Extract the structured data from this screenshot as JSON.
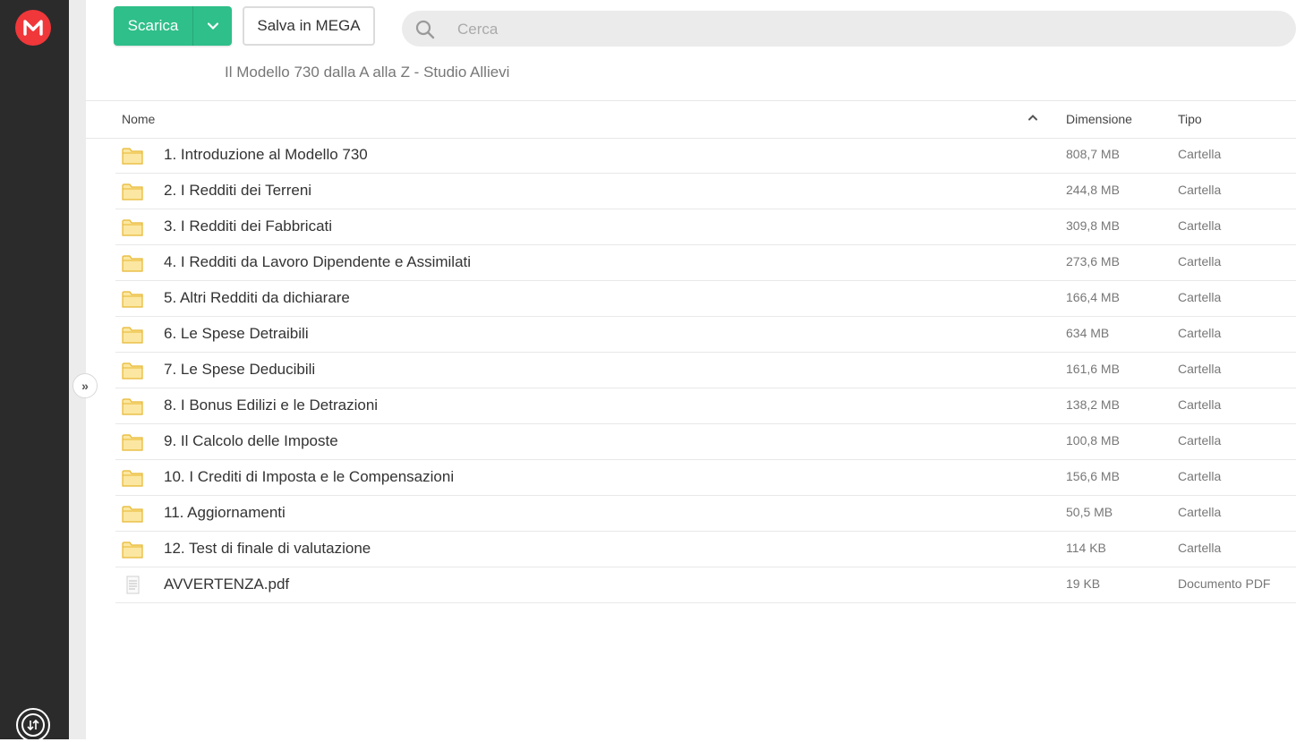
{
  "sidebar": {
    "logo_letter": "M",
    "logo_color": "#f0373a",
    "transfer_icon": "transfer-arrows-icon",
    "expand_glyph": "»"
  },
  "toolbar": {
    "download_label": "Scarica",
    "download_color": "#2fbf8a",
    "save_label": "Salva in MEGA"
  },
  "search": {
    "placeholder": "Cerca",
    "value": ""
  },
  "folder_title": "Il Modello 730 dalla A alla Z - Studio Allievi",
  "table": {
    "columns": {
      "name": "Nome",
      "size": "Dimensione",
      "type": "Tipo"
    },
    "sort": "ascending",
    "rows": [
      {
        "name": "1. Introduzione al Modello 730",
        "size": "808,7 MB",
        "type": "Cartella",
        "icon": "folder-icon"
      },
      {
        "name": "2. I Redditi dei Terreni",
        "size": "244,8 MB",
        "type": "Cartella",
        "icon": "folder-icon"
      },
      {
        "name": "3. I Redditi dei Fabbricati",
        "size": "309,8 MB",
        "type": "Cartella",
        "icon": "folder-icon"
      },
      {
        "name": "4. I Redditi da Lavoro Dipendente e Assimilati",
        "size": "273,6 MB",
        "type": "Cartella",
        "icon": "folder-icon"
      },
      {
        "name": "5. Altri Redditi da dichiarare",
        "size": "166,4 MB",
        "type": "Cartella",
        "icon": "folder-icon"
      },
      {
        "name": "6. Le Spese Detraibili",
        "size": "634 MB",
        "type": "Cartella",
        "icon": "folder-icon"
      },
      {
        "name": "7. Le Spese Deducibili",
        "size": "161,6 MB",
        "type": "Cartella",
        "icon": "folder-icon"
      },
      {
        "name": "8. I Bonus Edilizi e le Detrazioni",
        "size": "138,2 MB",
        "type": "Cartella",
        "icon": "folder-icon"
      },
      {
        "name": "9. Il Calcolo delle Imposte",
        "size": "100,8 MB",
        "type": "Cartella",
        "icon": "folder-icon"
      },
      {
        "name": "10. I Crediti di Imposta e le Compensazioni",
        "size": "156,6 MB",
        "type": "Cartella",
        "icon": "folder-icon"
      },
      {
        "name": "11. Aggiornamenti",
        "size": "50,5 MB",
        "type": "Cartella",
        "icon": "folder-icon"
      },
      {
        "name": "12. Test di finale di valutazione",
        "size": "114 KB",
        "type": "Cartella",
        "icon": "folder-icon"
      },
      {
        "name": "AVVERTENZA.pdf",
        "size": "19 KB",
        "type": "Documento PDF",
        "icon": "pdf-file-icon"
      }
    ]
  }
}
